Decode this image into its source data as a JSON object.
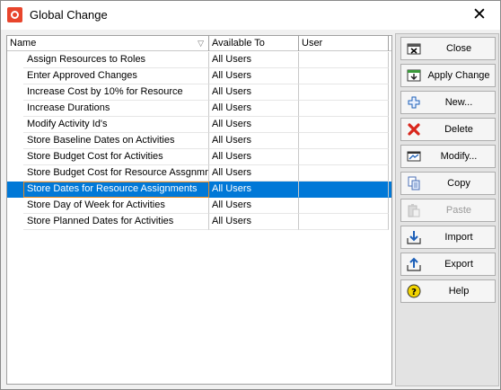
{
  "window": {
    "title": "Global Change",
    "close_glyph": "✕"
  },
  "grid": {
    "columns": [
      {
        "label": "Name",
        "sort_glyph": "▽"
      },
      {
        "label": "Available To"
      },
      {
        "label": "User"
      }
    ],
    "rows": [
      {
        "name": "Assign Resources to Roles",
        "available_to": "All Users",
        "user": ""
      },
      {
        "name": "Enter Approved Changes",
        "available_to": "All Users",
        "user": ""
      },
      {
        "name": "Increase Cost by 10% for Resource",
        "available_to": "All Users",
        "user": ""
      },
      {
        "name": "Increase Durations",
        "available_to": "All Users",
        "user": ""
      },
      {
        "name": "Modify Activity Id's",
        "available_to": "All Users",
        "user": ""
      },
      {
        "name": "Store Baseline Dates on Activities",
        "available_to": "All Users",
        "user": ""
      },
      {
        "name": "Store Budget Cost for Activities",
        "available_to": "All Users",
        "user": ""
      },
      {
        "name": "Store Budget Cost for Resource Assgnmn",
        "available_to": "All Users",
        "user": ""
      },
      {
        "name": "Store Dates for Resource Assignments",
        "available_to": "All Users",
        "user": "",
        "selected": true
      },
      {
        "name": "Store Day of Week for Activities",
        "available_to": "All Users",
        "user": ""
      },
      {
        "name": "Store Planned Dates for Activities",
        "available_to": "All Users",
        "user": ""
      }
    ]
  },
  "buttons": {
    "close": {
      "label": "Close",
      "icon": "close-dialog-icon"
    },
    "apply_change": {
      "label": "Apply Change",
      "icon": "apply-change-icon"
    },
    "new": {
      "label": "New...",
      "icon": "plus-icon"
    },
    "delete": {
      "label": "Delete",
      "icon": "red-x-icon",
      "color": "#d9261c"
    },
    "modify": {
      "label": "Modify...",
      "icon": "modify-icon"
    },
    "copy": {
      "label": "Copy",
      "icon": "copy-icon"
    },
    "paste": {
      "label": "Paste",
      "icon": "paste-icon",
      "disabled": true
    },
    "import": {
      "label": "Import",
      "icon": "import-icon"
    },
    "export": {
      "label": "Export",
      "icon": "export-icon"
    },
    "help": {
      "label": "Help",
      "icon": "help-icon",
      "color": "#f2d400"
    }
  },
  "colors": {
    "selection": "#0078d7",
    "focus_outline": "#e58a25",
    "accent_blue": "#1c5fb8"
  }
}
